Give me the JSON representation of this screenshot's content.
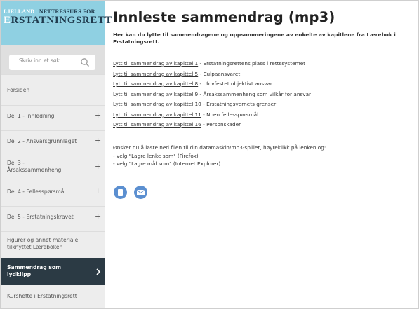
{
  "logo": {
    "small_text_part1": "LJELLAND",
    "small_text_part2": "NETTRESSURS FOR",
    "big_text_part1": "E",
    "big_text_part2": "RSTATNINGSRETT"
  },
  "search": {
    "placeholder": "Skriv inn et søk",
    "icon": "search-icon"
  },
  "sidebar": {
    "items": [
      {
        "label": "Forsiden",
        "has_plus": false
      },
      {
        "label": "Del 1 - Innledning",
        "has_plus": true
      },
      {
        "label": "Del 2 - Ansvarsgrunnlaget",
        "has_plus": true
      },
      {
        "label": "Del 3 - Årsakssammenheng",
        "has_plus": true
      },
      {
        "label": "Del 4 - Fellesspørsmål",
        "has_plus": true
      },
      {
        "label": "Del 5 - Erstatningskravet",
        "has_plus": true
      },
      {
        "label": "Figurer og annet materiale tilknyttet Læreboken",
        "has_plus": false
      },
      {
        "label": "Sammendrag som lydklipp",
        "active": true
      },
      {
        "label": "Kurshefte i Erstatningsrett",
        "has_plus": false
      }
    ],
    "plus_symbol": "+"
  },
  "main": {
    "title": "Innleste sammendrag (mp3)",
    "intro": "Her kan du lytte til sammendragene og oppsummeringene av enkelte av kapitlene fra Lærebok i Erstatningsrett.",
    "links": [
      {
        "link": "Lytt til sammendrag av kapittel 1",
        "desc": " - Erstatningsrettens plass i rettssystemet"
      },
      {
        "link": "Lytt til sammendrag av kapittel 5",
        "desc": " - Culpaansvaret"
      },
      {
        "link": "Lytt til sammendrag av kapittel 8",
        "desc": " - Ulovfestet objektivt ansvar"
      },
      {
        "link": "Lytt til sammendrag av kapittel 9",
        "desc": " - Årsakssammenheng som vilkår for ansvar"
      },
      {
        "link": "Lytt til sammendrag av kapittel 10",
        "desc": " - Erstatningsvernets grenser"
      },
      {
        "link": "Lytt til sammendrag av kapittel 11",
        "desc": " - Noen fellesspørsmål"
      },
      {
        "link": "Lytt til sammendrag av kapittel 16",
        "desc": " - Personskader"
      }
    ],
    "download_info": [
      "Ønsker du å laste ned filen til din datamaskin/mp3-spiller, høyreklikk på lenken og:",
      "- velg \"Lagre lenke som\" (Firefox)",
      "- velg \"Lagre mål som\" (Internet Explorer)"
    ],
    "share_icons": [
      "print-icon",
      "email-icon"
    ]
  },
  "colors": {
    "sidebar_bg": "#ededed",
    "active_item_bg": "#2b3a44",
    "logo_bg": "#8fd0e2",
    "share_icon_bg": "#5b8fd0"
  }
}
